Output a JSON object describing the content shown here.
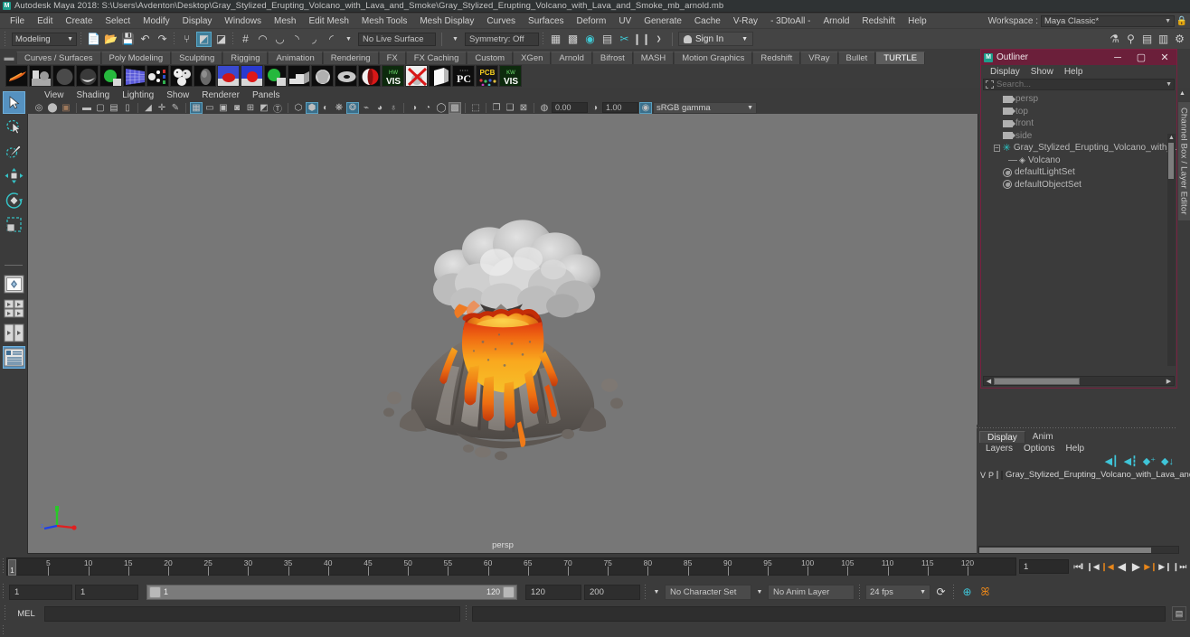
{
  "titlebar": {
    "app_icon": "maya-logo-icon",
    "title": "Autodesk Maya 2018: S:\\Users\\Avdenton\\Desktop\\Gray_Stylized_Erupting_Volcano_with_Lava_and_Smoke\\Gray_Stylized_Erupting_Volcano_with_Lava_and_Smoke_mb_arnold.mb"
  },
  "menubar": {
    "items": [
      "File",
      "Edit",
      "Create",
      "Select",
      "Modify",
      "Display",
      "Windows",
      "Mesh",
      "Edit Mesh",
      "Mesh Tools",
      "Mesh Display",
      "Curves",
      "Surfaces",
      "Deform",
      "UV",
      "Generate",
      "Cache",
      "V-Ray",
      "- 3DtoAll -",
      "Arnold",
      "Redshift",
      "Help"
    ],
    "workspace_label": "Workspace :",
    "workspace_value": "Maya Classic*"
  },
  "statusline": {
    "menuset": "Modeling",
    "live_surface": "No Live Surface",
    "symmetry": "Symmetry: Off",
    "signin": "Sign In"
  },
  "shelf": {
    "tabs": [
      "Curves / Surfaces",
      "Poly Modeling",
      "Sculpting",
      "Rigging",
      "Animation",
      "Rendering",
      "FX",
      "FX Caching",
      "Custom",
      "XGen",
      "Arnold",
      "Bifrost",
      "MASH",
      "Motion Graphics",
      "Redshift",
      "VRay",
      "Bullet",
      "TURTLE"
    ],
    "active_tab": "TURTLE",
    "icon_labels": [
      "flame-icon",
      "objects-icon",
      "sphere-icon",
      "shaded-sphere-icon",
      "green-sphere-icon",
      "grid-blue-icon",
      "particles-icon",
      "faces-icon",
      "dark-sphere-icon",
      "red-light-icon",
      "red-light2-icon",
      "green-sphere2-icon",
      "stairs-icon",
      "facet-sphere-icon",
      "torus-icon",
      "half-red-sphere-icon",
      "hw-vis-icon",
      "x-render-icon",
      "cube-icon",
      "pc-icon",
      "pcb-icon",
      "kw-vis-icon"
    ]
  },
  "toolbox": {
    "tools": [
      "select-tool",
      "lasso-select-tool",
      "paint-select-tool",
      "move-tool",
      "rotate-tool",
      "scale-tool",
      "last-tool",
      "single-view-layout",
      "four-view-layout",
      "two-pane-layout",
      "outliner-persp-layout"
    ],
    "selected": "select-tool"
  },
  "viewport": {
    "menubar": [
      "View",
      "Shading",
      "Lighting",
      "Show",
      "Renderer",
      "Panels"
    ],
    "exposure_value": "0.00",
    "gamma_value": "1.00",
    "color_space": "sRGB gamma",
    "camera_label": "persp",
    "axis": {
      "x": "x",
      "y": "y",
      "z": "z"
    },
    "background_color": "#777777"
  },
  "outliner": {
    "title": "Outliner",
    "window_buttons": [
      "minimize",
      "maximize",
      "close"
    ],
    "menus": [
      "Display",
      "Show",
      "Help"
    ],
    "search_placeholder": "Search...",
    "tree": [
      {
        "label": "persp",
        "icon": "camera-icon",
        "depth": 1,
        "dim": true
      },
      {
        "label": "top",
        "icon": "camera-icon",
        "depth": 1,
        "dim": true
      },
      {
        "label": "front",
        "icon": "camera-icon",
        "depth": 1,
        "dim": true
      },
      {
        "label": "side",
        "icon": "camera-icon",
        "depth": 1,
        "dim": true
      },
      {
        "label": "Gray_Stylized_Erupting_Volcano_with_Lava_and_S",
        "icon": "group-star-icon",
        "depth": 0,
        "dim": false,
        "expanded": true
      },
      {
        "label": "Volcano",
        "icon": "mesh-icon",
        "depth": 2,
        "dim": false
      },
      {
        "label": "defaultLightSet",
        "icon": "set-icon",
        "depth": 1,
        "dim": false
      },
      {
        "label": "defaultObjectSet",
        "icon": "set-icon",
        "depth": 1,
        "dim": false
      }
    ]
  },
  "layer_editor": {
    "tabs": [
      "Display",
      "Anim"
    ],
    "active_tab": "Display",
    "menus": [
      "Layers",
      "Options",
      "Help"
    ],
    "toolbar_icons": [
      "layer-prev-icon",
      "layer-next-icon",
      "layer-add-icon",
      "layer-add-selected-icon"
    ],
    "rows": [
      {
        "v": "V",
        "p": "P",
        "color": "#c2173e",
        "label": "Gray_Stylized_Erupting_Volcano_with_Lava_and_Sm"
      }
    ]
  },
  "right_tabs": {
    "channel_box": "Channel Box / Layer Editor"
  },
  "timeslider": {
    "current_frame": "1",
    "tick_labels": [
      "5",
      "10",
      "15",
      "20",
      "25",
      "30",
      "35",
      "40",
      "45",
      "50",
      "55",
      "60",
      "65",
      "70",
      "75",
      "80",
      "85",
      "90",
      "95",
      "100",
      "105",
      "110",
      "115",
      "120"
    ],
    "range_start": 1,
    "range_end": 120,
    "current_field": "1",
    "playback_buttons": [
      "go-to-start",
      "step-back-key",
      "step-back-frame",
      "play-backwards",
      "play-forwards",
      "step-forward-frame",
      "step-forward-key",
      "go-to-end"
    ]
  },
  "rangeslider": {
    "anim_start": "1",
    "range_start": "1",
    "bar_start_label": "1",
    "bar_end_label": "120",
    "range_end": "120",
    "anim_end": "200",
    "character_set": "No Character Set",
    "anim_layer": "No Anim Layer",
    "fps": "24 fps",
    "icons": [
      "cycle-icon",
      "auto-key-icon",
      "animation-prefs-icon"
    ]
  },
  "commandline": {
    "mode": "MEL",
    "input_value": "",
    "output_value": "",
    "script_editor_icon": "script-editor-icon"
  }
}
